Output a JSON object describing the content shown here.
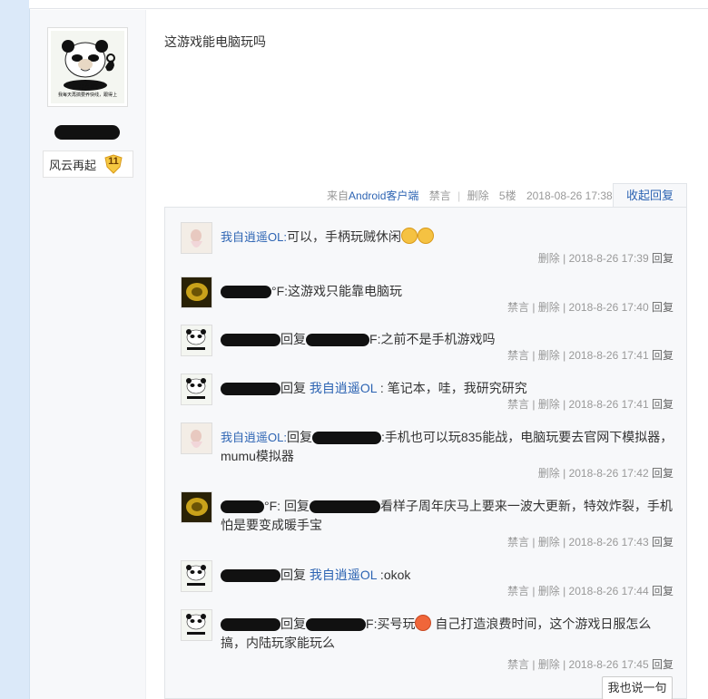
{
  "post": {
    "content": "这游戏能电脑玩吗",
    "badge_label": "风云再起",
    "badge_level": "11",
    "source_prefix": "来自",
    "source_client": "Android客户端",
    "ban": "禁言",
    "delete": "删除",
    "floor": "5楼",
    "time": "2018-08-26 17:38",
    "collapse": "收起回复",
    "avatar_caption_1": "开车吧",
    "avatar_caption_2": "我每天再搞要养快线，跟得上"
  },
  "replies": [
    {
      "user": "我自逍遥OL",
      "segments": [
        "我自逍遥OL:",
        "可以，手柄玩贼休闲"
      ],
      "emojis": 2,
      "meta": "删除 | 2018-8-26 17:39",
      "reply": "回复"
    },
    {
      "user": "",
      "segments": [
        "°F",
        ":这游戏只能靠电脑玩"
      ],
      "meta": "禁言 | 删除 | 2018-8-26 17:40",
      "reply": "回复"
    },
    {
      "user": "",
      "segments": [
        "回复",
        "F",
        ":之前不是手机游戏吗"
      ],
      "meta": "禁言 | 删除 | 2018-8-26 17:41",
      "reply": "回复"
    },
    {
      "user": "",
      "segments": [
        "回复",
        "我自逍遥OL",
        " : 笔记本，哇，我研究研究"
      ],
      "meta": "禁言 | 删除 | 2018-8-26 17:41",
      "reply": "回复"
    },
    {
      "user": "我自逍遥OL",
      "segments": [
        "我自逍遥OL:",
        "回复",
        ":手机也可以玩835能战，电脑玩要去官网下模拟器，mumu模拟器"
      ],
      "meta": "删除 | 2018-8-26 17:42",
      "reply": "回复"
    },
    {
      "user": "",
      "segments": [
        "°F",
        ":",
        "回复",
        "看样子周年庆马上要来一波大更新，特效炸裂，手机怕是要变成暖手宝"
      ],
      "meta": "禁言 | 删除 | 2018-8-26 17:43",
      "reply": "回复"
    },
    {
      "user": "",
      "segments": [
        "回复",
        "我自逍遥OL",
        " :okok"
      ],
      "meta": "禁言 | 删除 | 2018-8-26 17:44",
      "reply": "回复"
    },
    {
      "user": "",
      "segments": [
        "回复",
        "F",
        ":买号玩",
        " 自己打造浪费时间，这个游戏日服怎么搞，内陆玩家能玩么"
      ],
      "meta": "禁言 | 删除 | 2018-8-26 17:45",
      "reply": "回复"
    }
  ],
  "say_button": "我也说一句",
  "colors": {
    "link": "#2d64b3",
    "meta": "#999999",
    "bg": "#dfeefc"
  }
}
